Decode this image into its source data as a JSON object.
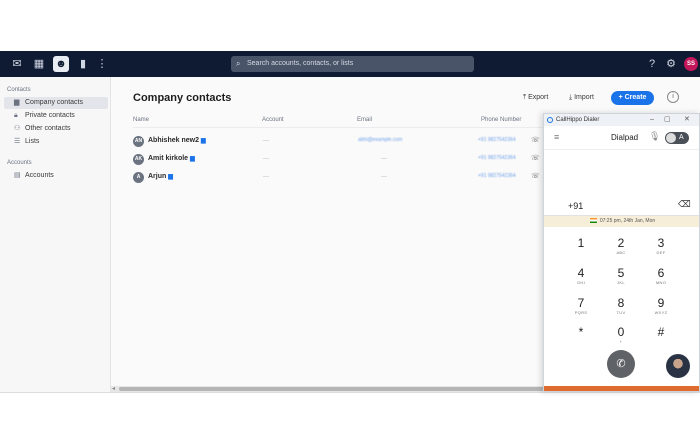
{
  "topbar": {
    "search_placeholder": "Search accounts, contacts, or lists",
    "user_initials": "SS"
  },
  "sidebar": {
    "contacts_section": "Contacts",
    "contacts_items": [
      {
        "label": "Company contacts",
        "icon": "building-icon",
        "active": true
      },
      {
        "label": "Private contacts",
        "icon": "lock-icon",
        "active": false
      },
      {
        "label": "Other contacts",
        "icon": "people-icon",
        "active": false
      },
      {
        "label": "Lists",
        "icon": "list-icon",
        "active": false
      }
    ],
    "accounts_section": "Accounts",
    "accounts_items": [
      {
        "label": "Accounts",
        "icon": "briefcase-icon",
        "active": false
      }
    ]
  },
  "main": {
    "title": "Company contacts",
    "actions": {
      "export": "Export",
      "import": "Import",
      "create": "Create"
    },
    "columns": [
      "Name",
      "Account",
      "Email",
      "Phone Number"
    ],
    "rows": [
      {
        "initials": "AN",
        "name": "Abhishek new2",
        "account": "—",
        "email": "abhi@example.com",
        "phone": "+91 9827542364"
      },
      {
        "initials": "AK",
        "name": "Amit kirkole",
        "account": "—",
        "email": "—",
        "phone": "+91 9827542364"
      },
      {
        "initials": "A",
        "name": "Arjun",
        "account": "—",
        "email": "—",
        "phone": "+91 9827542364"
      }
    ]
  },
  "dialer": {
    "window_title": "CallHippo Dialer",
    "mode": "Dialpad",
    "toggle_label": "A",
    "country_code": "+91",
    "datetime": "07:25 pm, 24th Jan, Mon",
    "keys": [
      {
        "digit": "1",
        "letters": ""
      },
      {
        "digit": "2",
        "letters": "ABC"
      },
      {
        "digit": "3",
        "letters": "DEF"
      },
      {
        "digit": "4",
        "letters": "GHI"
      },
      {
        "digit": "5",
        "letters": "JKL"
      },
      {
        "digit": "6",
        "letters": "MNO"
      },
      {
        "digit": "7",
        "letters": "PQRS"
      },
      {
        "digit": "8",
        "letters": "TUV"
      },
      {
        "digit": "9",
        "letters": "WXYZ"
      },
      {
        "digit": "*",
        "letters": ""
      },
      {
        "digit": "0",
        "letters": "+"
      },
      {
        "digit": "#",
        "letters": ""
      }
    ],
    "colors": {
      "accent": "#1a73e8",
      "call_button": "#5f6266",
      "bottom_bar": "#e06b2f"
    }
  }
}
